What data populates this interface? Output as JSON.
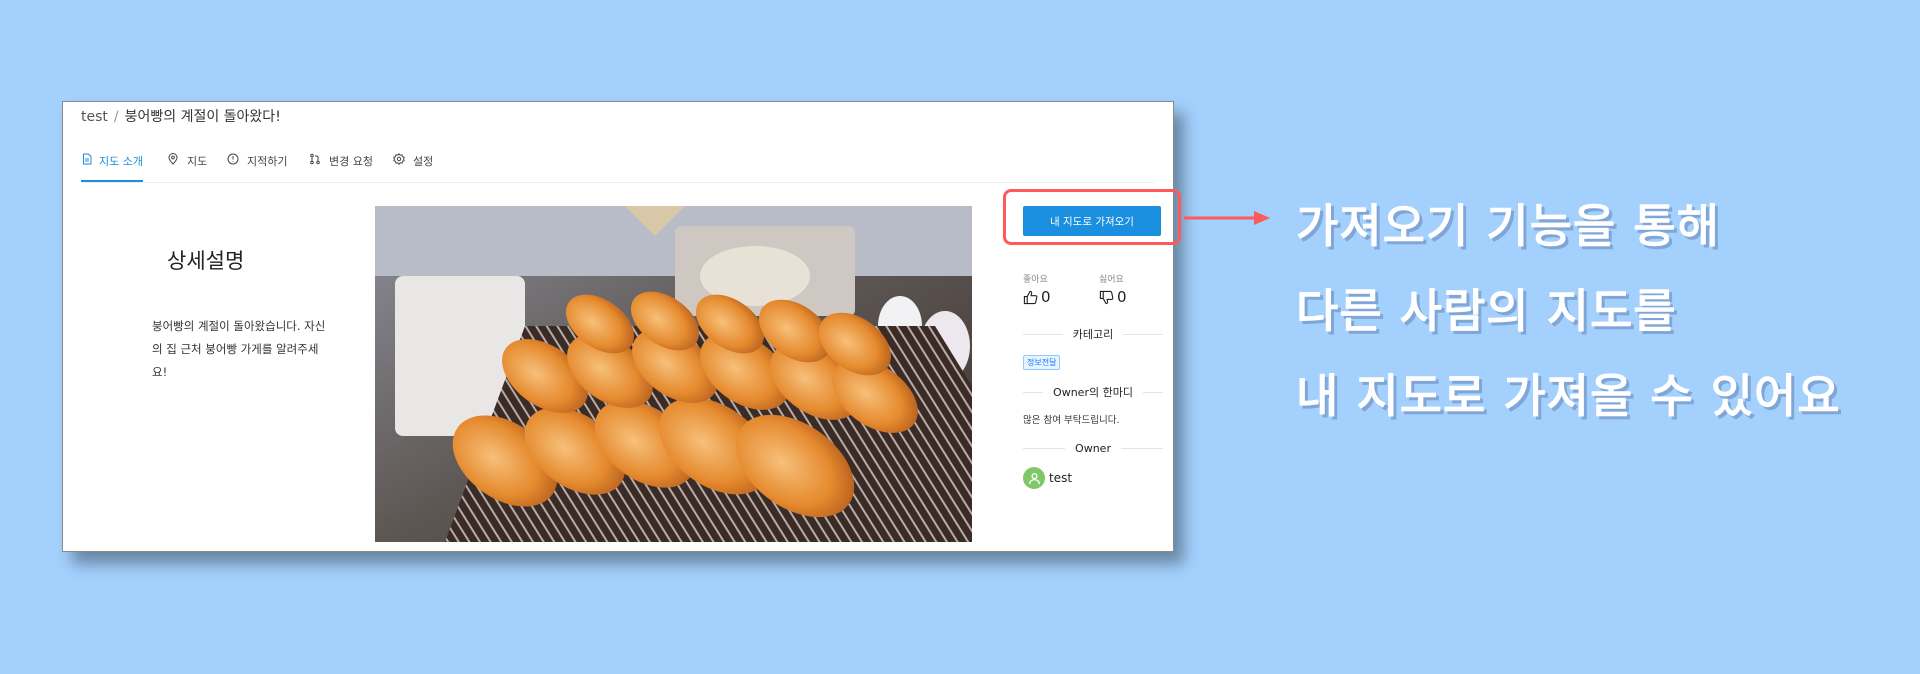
{
  "breadcrumb": {
    "user": "test",
    "separator": "/",
    "title": "붕어빵의 계절이 돌아왔다!"
  },
  "tabs": [
    {
      "label": "지도 소개",
      "icon": "file-text-icon",
      "active": true
    },
    {
      "label": "지도",
      "icon": "map-pin-icon",
      "active": false
    },
    {
      "label": "지적하기",
      "icon": "alert-circle-icon",
      "active": false
    },
    {
      "label": "변경 요청",
      "icon": "pull-request-icon",
      "active": false
    },
    {
      "label": "설정",
      "icon": "gear-icon",
      "active": false
    }
  ],
  "description": {
    "title": "상세설명",
    "body": "붕어빵의 계절이 돌아왔습니다. 자신의 집 근처 붕어빵 가게를 알려주세요!"
  },
  "sidebar": {
    "import_button": "내 지도로 가져오기",
    "like": {
      "label": "좋아요",
      "count": "0",
      "icon": "thumbs-up-icon"
    },
    "dislike": {
      "label": "싫어요",
      "count": "0",
      "icon": "thumbs-down-icon"
    },
    "category_heading": "카테고리",
    "category_tag": "정보전달",
    "comment_heading": "Owner의 한마디",
    "comment": "많은 참여 부탁드립니다.",
    "owner_heading": "Owner",
    "owner_name": "test"
  },
  "annotation": {
    "lines": [
      "가져오기 기능을 통해",
      "다른 사람의 지도를",
      "내 지도로 가져올 수 있어요"
    ]
  },
  "colors": {
    "background": "#a3d0fd",
    "accent": "#1a8fe0",
    "highlight": "#ff5a5a",
    "caption": "#ffffff"
  }
}
